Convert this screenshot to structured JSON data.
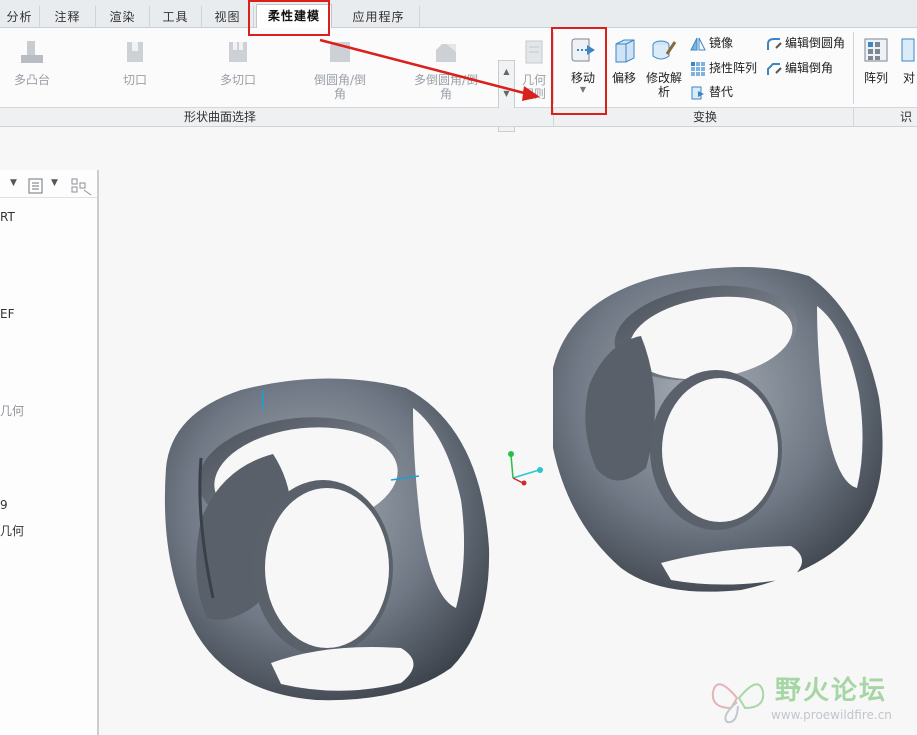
{
  "tabs": [
    {
      "label": "分析",
      "active": false
    },
    {
      "label": "注释",
      "active": false
    },
    {
      "label": "渲染",
      "active": false
    },
    {
      "label": "工具",
      "active": false
    },
    {
      "label": "视图",
      "active": false
    },
    {
      "label": "柔性建模",
      "active": true
    },
    {
      "label": "应用程序",
      "active": false
    }
  ],
  "ribbon": {
    "shape_surface_group": {
      "label": "形状曲面选择",
      "items": [
        {
          "label": "多凸台",
          "enabled": false
        },
        {
          "label": "切口",
          "enabled": false
        },
        {
          "label": "多切口",
          "enabled": false
        },
        {
          "label": "倒圆角/倒角",
          "enabled": false
        },
        {
          "label": "多倒圆角/倒角",
          "enabled": false
        },
        {
          "label": "几何规则",
          "enabled": false
        }
      ]
    },
    "transform_group": {
      "label": "变换",
      "move": "移动",
      "offset": "偏移",
      "modify_analysis": "修改解析",
      "mirror": "镜像",
      "flex_pattern": "挠性阵列",
      "substitute": "替代",
      "edit_round": "编辑倒圆角",
      "edit_chamfer": "编辑倒角"
    },
    "recognition_group": {
      "label": "识",
      "pattern": "阵列",
      "symmetry": "对"
    }
  },
  "model_tree": {
    "items": [
      {
        "label": "RT",
        "dim": false
      },
      {
        "label": "EF",
        "dim": false
      },
      {
        "label": "几何",
        "dim": true
      },
      {
        "label": "9",
        "dim": false
      },
      {
        "label": "几何",
        "dim": false
      }
    ]
  },
  "watermark": {
    "title": "野火论坛",
    "url": "www.proewildfire.cn"
  },
  "colors": {
    "highlight": "#d9201c",
    "model_body": "#6b7480",
    "accent_icon": "#3c86c6"
  }
}
